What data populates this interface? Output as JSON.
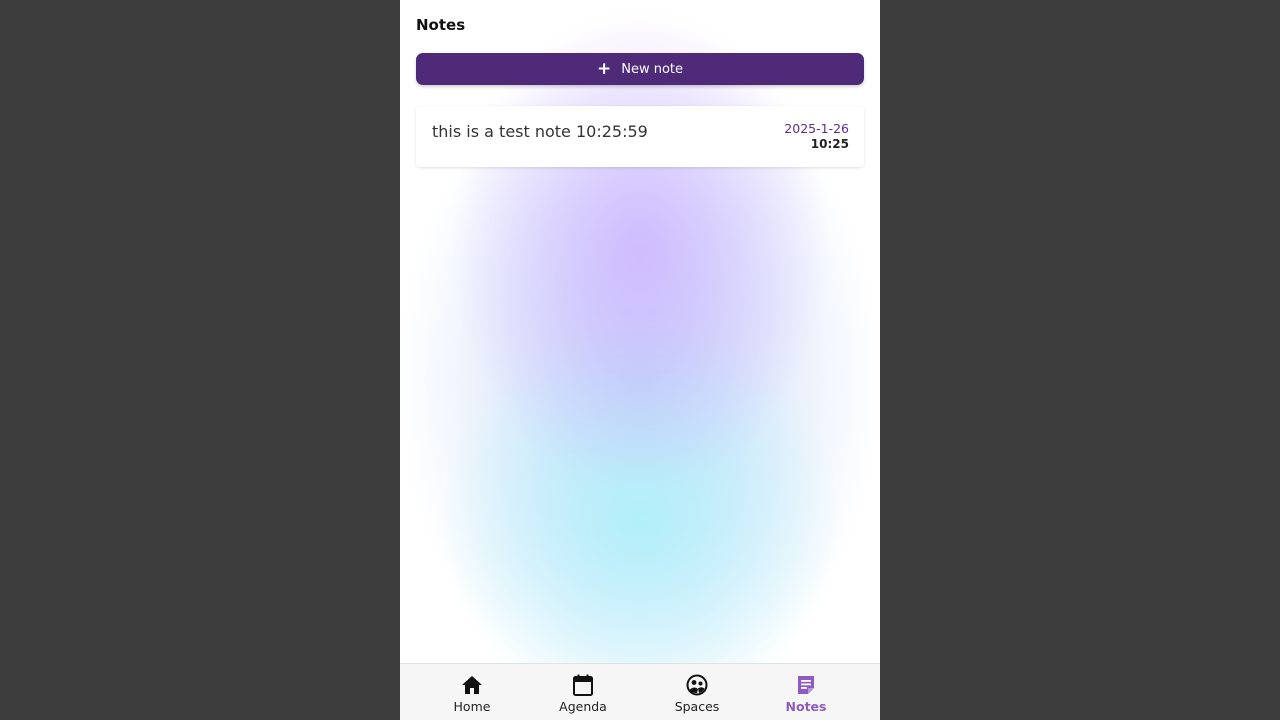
{
  "header": {
    "title": "Notes"
  },
  "actions": {
    "new_note_label": "New note",
    "new_note_icon": "plus-icon"
  },
  "notes": [
    {
      "text": "this is a test note 10:25:59",
      "date": "2025-1-26",
      "time": "10:25"
    }
  ],
  "nav": {
    "items": [
      {
        "label": "Home",
        "icon": "home-icon",
        "active": false
      },
      {
        "label": "Agenda",
        "icon": "calendar-icon",
        "active": false
      },
      {
        "label": "Spaces",
        "icon": "spaces-icon",
        "active": false
      },
      {
        "label": "Notes",
        "icon": "notes-icon",
        "active": true
      }
    ]
  },
  "colors": {
    "primary": "#4e2a79",
    "active_nav": "#8e5cc0",
    "date_text": "#5a2d8f",
    "page_background": "#3c3c3c"
  }
}
